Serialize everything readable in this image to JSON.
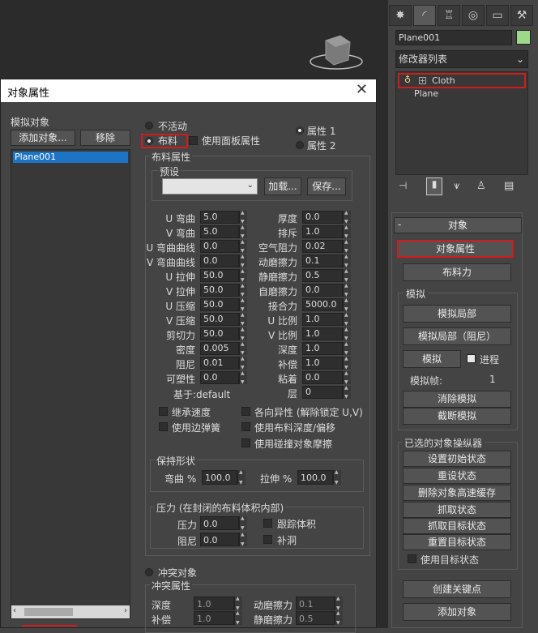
{
  "command_panel": {
    "object_name": "Plane001",
    "modifier_list": "修改器列表",
    "stack": [
      "Cloth",
      "Plane"
    ],
    "object_rollout": {
      "header": "对象",
      "object_props_btn": "对象属性",
      "cloth_force_btn": "布料力",
      "simulation_group": "模拟",
      "sim_local_btn": "模拟局部",
      "sim_local_damped_btn": "模拟局部（阻尼）",
      "simulate_btn": "模拟",
      "progress_label": "进程",
      "sim_frames_label": "模拟帧:",
      "sim_frames_value": "1",
      "erase_sim_btn": "消除模拟",
      "truncate_sim_btn": "截断模拟",
      "selected_group": "已选的对象操纵器",
      "set_initial_btn": "设置初始状态",
      "reset_state_btn": "重设状态",
      "delete_cache_btn": "删除对象高速缓存",
      "grab_state_btn": "抓取状态",
      "grab_target_btn": "抓取目标状态",
      "reset_target_btn": "重置目标状态",
      "use_target_label": "使用目标状态",
      "create_keys_btn": "创建关键点",
      "add_objects_btn": "添加对象"
    }
  },
  "dialog": {
    "title": "对象属性",
    "close": "✕",
    "sim_objects_label": "模拟对象",
    "add_object_btn": "添加对象...",
    "remove_btn": "移除",
    "list": [
      "Plane001"
    ],
    "inactive_label": "不活动",
    "cloth_label": "布料",
    "use_panel_label": "使用面板属性",
    "prop1_label": "属性 1",
    "prop2_label": "属性 2",
    "cloth_props_group": "布料属性",
    "presets_group": "预设",
    "load_btn": "加载...",
    "save_btn": "保存...",
    "left_params": [
      {
        "label": "U 弯曲",
        "value": "5.0"
      },
      {
        "label": "V 弯曲",
        "value": "5.0"
      },
      {
        "label": "U 弯曲曲线",
        "value": "0.0"
      },
      {
        "label": "V 弯曲曲线",
        "value": "0.0"
      },
      {
        "label": "U 拉伸",
        "value": "50.0"
      },
      {
        "label": "V 拉伸",
        "value": "50.0"
      },
      {
        "label": "U 压缩",
        "value": "50.0"
      },
      {
        "label": "V 压缩",
        "value": "50.0"
      },
      {
        "label": "剪切力",
        "value": "50.0"
      },
      {
        "label": "密度",
        "value": "0.005"
      },
      {
        "label": "阻尼",
        "value": "0.01"
      },
      {
        "label": "可塑性",
        "value": "0.0"
      }
    ],
    "right_params": [
      {
        "label": "厚度",
        "value": "0.0"
      },
      {
        "label": "排斥",
        "value": "1.0"
      },
      {
        "label": "空气阻力",
        "value": "0.02"
      },
      {
        "label": "动磨擦力",
        "value": "0.1"
      },
      {
        "label": "静磨擦力",
        "value": "0.5"
      },
      {
        "label": "自磨擦力",
        "value": "0.0"
      },
      {
        "label": "接合力",
        "value": "5000.0"
      },
      {
        "label": "U 比例",
        "value": "1.0"
      },
      {
        "label": "V 比例",
        "value": "1.0"
      },
      {
        "label": "深度",
        "value": "1.0"
      },
      {
        "label": "补偿",
        "value": "1.0"
      },
      {
        "label": "粘着",
        "value": "0.0"
      },
      {
        "label": "层",
        "value": "0"
      }
    ],
    "based_on": "基于:default",
    "inherit_velocity": "继承速度",
    "use_edge_springs": "使用边弹簧",
    "anisotropic": "各向异性 (解除锁定 U,V)",
    "use_cloth_depth": "使用布料深度/偏移",
    "use_collision_friction": "使用碰撞对象摩擦",
    "keep_shape_group": "保持形状",
    "bend_pct_label": "弯曲 %",
    "bend_pct_value": "100.0",
    "stretch_pct_label": "拉伸 %",
    "stretch_pct_value": "100.0",
    "pressure_group": "压力 (在封闭的布料体积内部)",
    "pressure_label": "压力",
    "pressure_value": "0.0",
    "p_damping_label": "阻尼",
    "p_damping_value": "0.0",
    "track_volume": "跟踪体积",
    "cap_holes": "补洞",
    "collision_object_label": "冲突对象",
    "collision_props_group": "冲突属性",
    "c_depth_label": "深度",
    "c_depth_value": "1.0",
    "c_offset_label": "补偿",
    "c_offset_value": "1.0",
    "c_dyn_fric_label": "动磨擦力",
    "c_dyn_fric_value": "0.1",
    "c_static_fric_label": "静磨擦力",
    "c_static_fric_value": "0.5"
  }
}
